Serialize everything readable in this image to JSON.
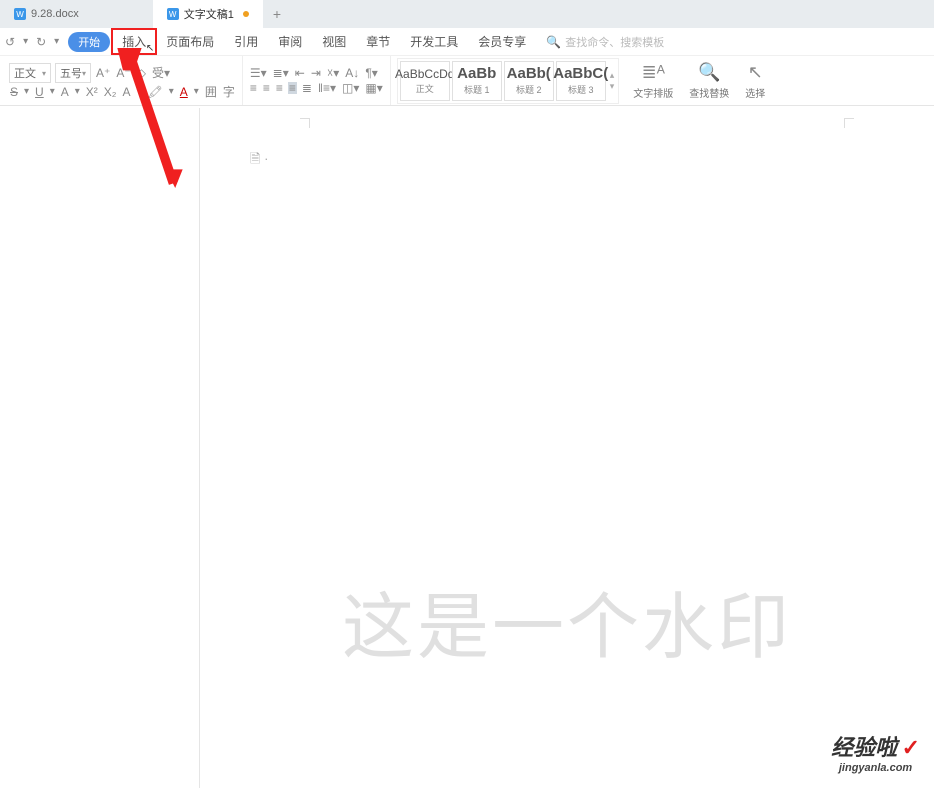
{
  "tabs": {
    "inactive": "9.28.docx",
    "active": "文字文稿1",
    "addTooltip": "+"
  },
  "menu": {
    "start": "开始",
    "insert": "插入",
    "layout": "页面布局",
    "reference": "引用",
    "review": "审阅",
    "view": "视图",
    "section": "章节",
    "devtools": "开发工具",
    "vip": "会员专享"
  },
  "search": {
    "placeholder": "查找命令、搜索模板"
  },
  "font": {
    "family": "正文",
    "size": "五号"
  },
  "styles": {
    "body": {
      "sample": "AaBbCcDd",
      "label": "正文"
    },
    "h1": {
      "sample": "AaBb",
      "label": "标题 1"
    },
    "h2": {
      "sample": "AaBb(",
      "label": "标题 2"
    },
    "h3": {
      "sample": "AaBbC(",
      "label": "标题 3"
    }
  },
  "ribbonRight": {
    "textLayout": "文字排版",
    "findReplace": "查找替换",
    "select": "选择"
  },
  "document": {
    "watermark": "这是一个水印"
  },
  "annotation": {
    "logo": "经验啦",
    "check": "✓",
    "url": "jingyanla.com"
  }
}
